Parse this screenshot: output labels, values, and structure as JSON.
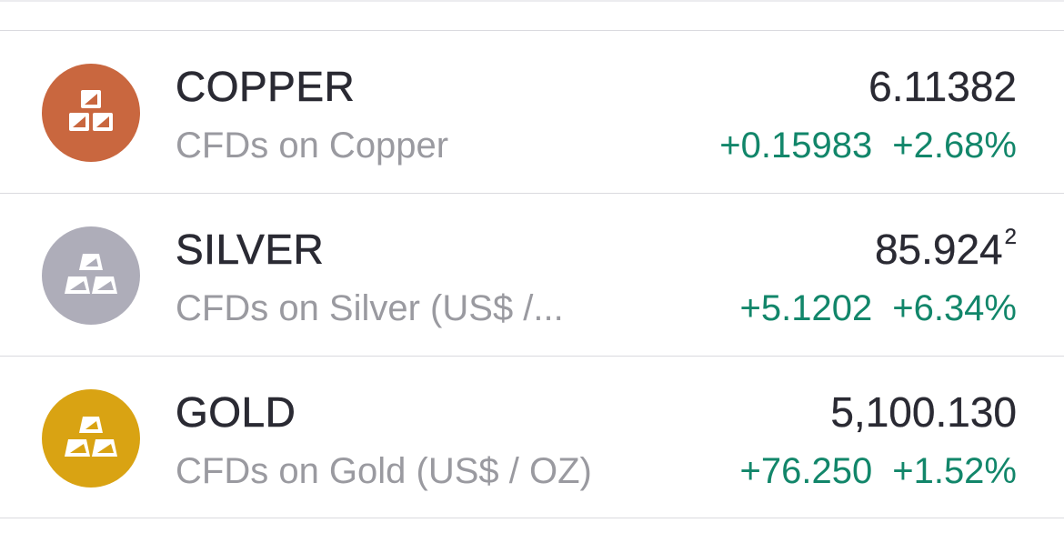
{
  "items": [
    {
      "symbol": "COPPER",
      "description": "CFDs on Copper",
      "price": "6.11382",
      "price_superscript": "",
      "change_abs": "+0.15983",
      "change_pct": "+2.68%",
      "icon": "copper-bars-icon",
      "icon_color": "#c9673f"
    },
    {
      "symbol": "SILVER",
      "description": "CFDs on Silver (US$ /...",
      "price": "85.924",
      "price_superscript": "2",
      "change_abs": "+5.1202",
      "change_pct": "+6.34%",
      "icon": "silver-bars-icon",
      "icon_color": "#aeadb9"
    },
    {
      "symbol": "GOLD",
      "description": "CFDs on Gold (US$ / OZ)",
      "price": "5,100.130",
      "price_superscript": "",
      "change_abs": "+76.250",
      "change_pct": "+1.52%",
      "icon": "gold-bars-icon",
      "icon_color": "#d9a313"
    }
  ],
  "colors": {
    "positive": "#12866a",
    "symbol_text": "#2a2a33",
    "secondary_text": "#9a9aa0",
    "divider": "#dadadf"
  }
}
